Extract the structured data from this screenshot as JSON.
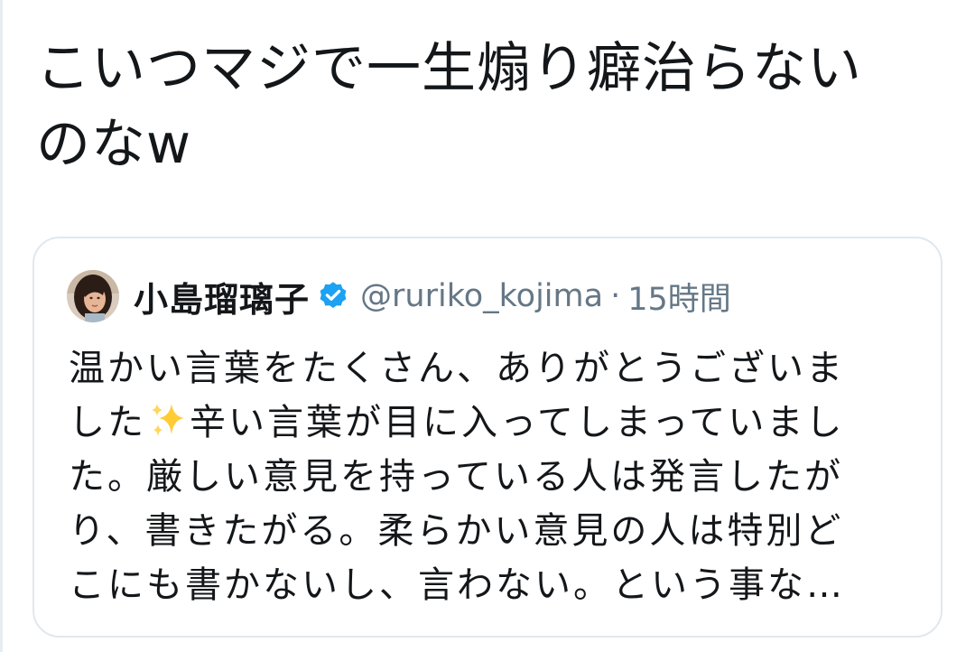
{
  "tweet": {
    "text_line1": "こいつマジで一生煽り癖治らない",
    "text_line2": "のなw"
  },
  "quoted_tweet": {
    "display_name": "小島瑠璃子",
    "handle": "@ruriko_kojima",
    "separator": "·",
    "time": "15時間",
    "verified": true,
    "avatar_icon": "profile-photo",
    "body": {
      "line1": "温かい言葉をたくさん、ありがとうございま",
      "line2_before_emoji": "した",
      "line2_emoji": "sparkles-icon",
      "line2_after_emoji": "辛い言葉が目に入ってしまっていまし",
      "line3": "た。厳しい意見を持っている人は発言したが",
      "line4": "り、書きたがる。柔らかい意見の人は特別ど",
      "line5": "こにも書かないし、言わない。という事な…"
    }
  },
  "colors": {
    "text_primary": "#14171a",
    "text_secondary": "#657786",
    "card_border": "#e1e8ed",
    "verified_blue": "#1da1f2",
    "sparkle_yellow": "#ffcc33"
  }
}
